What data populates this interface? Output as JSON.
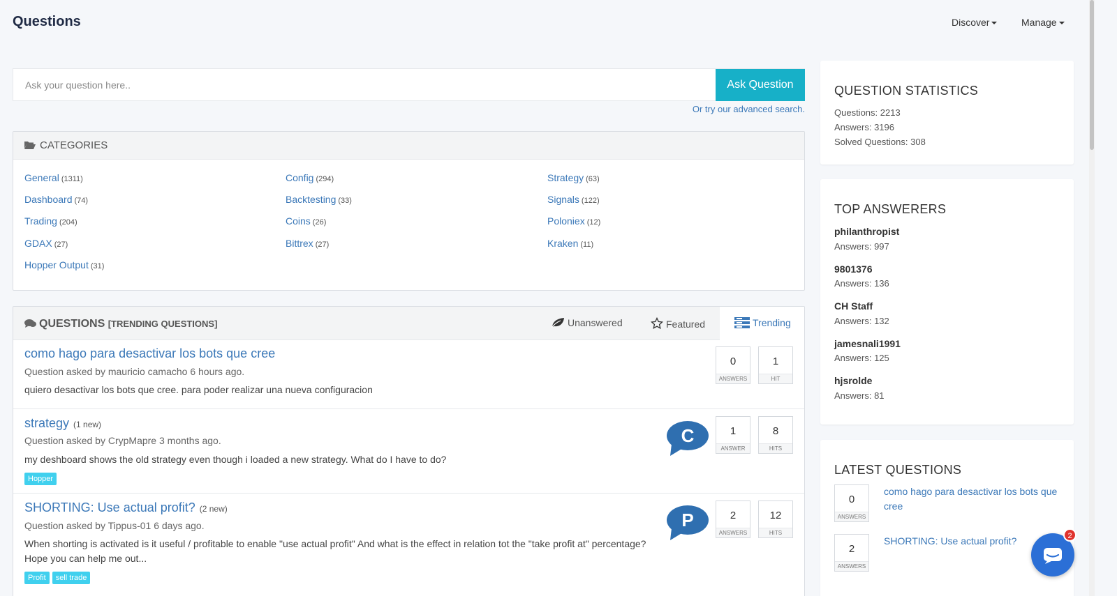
{
  "header": {
    "title": "Questions",
    "nav": [
      {
        "label": "Discover"
      },
      {
        "label": "Manage"
      }
    ]
  },
  "search": {
    "placeholder": "Ask your question here..",
    "button_label": "Ask Question",
    "advanced_link": "Or try our advanced search."
  },
  "categories": {
    "title": "CATEGORIES",
    "items": [
      {
        "name": "General",
        "count": "(1311)"
      },
      {
        "name": "Config",
        "count": "(294)"
      },
      {
        "name": "Strategy",
        "count": "(63)"
      },
      {
        "name": "Dashboard",
        "count": "(74)"
      },
      {
        "name": "Backtesting",
        "count": "(33)"
      },
      {
        "name": "Signals",
        "count": "(122)"
      },
      {
        "name": "Trading",
        "count": "(204)"
      },
      {
        "name": "Coins",
        "count": "(26)"
      },
      {
        "name": "Poloniex",
        "count": "(12)"
      },
      {
        "name": "GDAX",
        "count": "(27)"
      },
      {
        "name": "Bittrex",
        "count": "(27)"
      },
      {
        "name": "Kraken",
        "count": "(11)"
      },
      {
        "name": "Hopper Output",
        "count": "(31)"
      }
    ]
  },
  "questions": {
    "title": "QUESTIONS",
    "subtitle": "[TRENDING QUESTIONS]",
    "tabs": [
      {
        "label": "Unanswered"
      },
      {
        "label": "Featured"
      },
      {
        "label": "Trending"
      }
    ],
    "active_tab": "Trending",
    "list": [
      {
        "title": "como hago para desactivar los bots que cree",
        "new": "",
        "meta": "Question asked by mauricio camacho 6 hours ago.",
        "excerpt": "quiero desactivar los bots que cree. para poder realizar una nueva configuracion",
        "tags": [],
        "avatar": "",
        "answers": "0",
        "answers_label": "ANSWERS",
        "hits": "1",
        "hits_label": "HIT"
      },
      {
        "title": "strategy",
        "new": "(1 new)",
        "meta": "Question asked by CrypMapre 3 months ago.",
        "excerpt": "my deshboard shows the old strategy even though i loaded a new strategy. What do I have to do?",
        "tags": [
          "Hopper"
        ],
        "avatar": "C",
        "answers": "1",
        "answers_label": "ANSWER",
        "hits": "8",
        "hits_label": "HITS"
      },
      {
        "title": "SHORTING: Use actual profit?",
        "new": "(2 new)",
        "meta": "Question asked by Tippus-01 6 days ago.",
        "excerpt": "When shorting is activated is it useful / profitable to enable \"use actual profit\" And what is the effect in relation tot the \"take profit at\" percentage? Hope you can help me out...",
        "tags": [
          "Profit",
          "sell trade"
        ],
        "avatar": "P",
        "answers": "2",
        "answers_label": "ANSWERS",
        "hits": "12",
        "hits_label": "HITS"
      }
    ]
  },
  "stats": {
    "title": "QUESTION STATISTICS",
    "lines": [
      "Questions: 2213",
      "Answers: 3196",
      "Solved Questions: 308"
    ]
  },
  "top_answerers": {
    "title": "TOP ANSWERERS",
    "items": [
      {
        "name": "philanthropist",
        "answers": "Answers: 997"
      },
      {
        "name": "9801376",
        "answers": "Answers: 136"
      },
      {
        "name": "CH Staff",
        "answers": "Answers: 132"
      },
      {
        "name": "jamesnali1991",
        "answers": "Answers: 125"
      },
      {
        "name": "hjsrolde",
        "answers": "Answers: 81"
      }
    ]
  },
  "latest": {
    "title": "LATEST QUESTIONS",
    "items": [
      {
        "answers": "0",
        "label": "ANSWERS",
        "title": "como hago para desactivar los bots que cree"
      },
      {
        "answers": "2",
        "label": "ANSWERS",
        "title": "SHORTING: Use actual profit?"
      }
    ]
  },
  "chat": {
    "badge": "2"
  },
  "colors": {
    "accent": "#17b0c8",
    "link": "#3b78b8",
    "tag": "#40d0ee",
    "avatar": "#2f6fb0",
    "chat": "#2b6fd6"
  }
}
